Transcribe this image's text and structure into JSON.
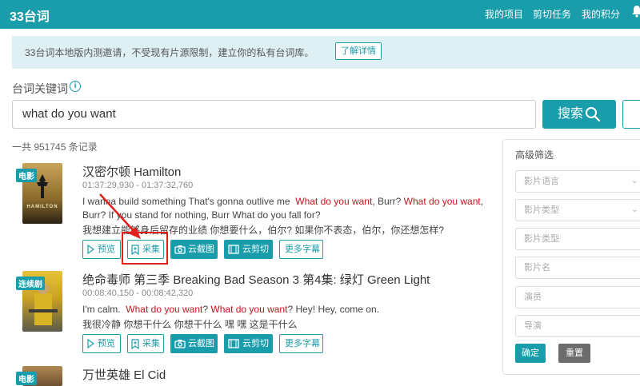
{
  "app": {
    "brand": "33台词",
    "nav": [
      "我的项目",
      "剪切任务",
      "我的积分"
    ]
  },
  "notice": {
    "text": "33台词本地版内测邀请，不受现有片源限制，建立你的私有台词库。",
    "button": "了解详情"
  },
  "search": {
    "label": "台词关键词",
    "value": "what do you want",
    "button": "搜索"
  },
  "total": "一共 951745 条记录",
  "results": [
    {
      "badge": "电影",
      "title": "汉密尔顿 Hamilton",
      "timecode": "01:37:29,930 - 01:37:32,760",
      "en_line1_a": "I wanna build something That's gonna outlive me",
      "en_line1_hl1": "What do you want",
      "en_line1_b": ", Burr?",
      "en_line1_hl2": "What do you want",
      "en_line1_c": ",",
      "en_line2": "Burr? If you stand for nothing, Burr What do you fall for?",
      "zh_line": "我想建立能够身后留存的业绩  你想要什么，伯尔?  如果你不表态，伯尔，你还想怎样?",
      "poster_text": "HAMILTON"
    },
    {
      "badge": "连续剧",
      "title": "绝命毒师 第三季 Breaking Bad Season 3 第4集: 绿灯 Green Light",
      "timecode": "00:08:40,150 - 00:08:42,320",
      "en_a": "I'm calm.",
      "en_hl1": "What do you want",
      "en_b": "?",
      "en_hl2": "What do you want",
      "en_c": "? Hey! Hey, come on.",
      "zh_line": "我很冷静  你想干什么  你想干什么  嘿  嘿  这是干什么"
    },
    {
      "badge": "电影",
      "title": "万世英雄 El Cid"
    }
  ],
  "actions": {
    "preview": "预览",
    "collect": "采集",
    "screenshot": "云截图",
    "cut": "云剪切",
    "more": "更多字幕"
  },
  "filter": {
    "title": "高级筛选",
    "fields": [
      "影片语言",
      "影片类型",
      "影片类型",
      "影片名",
      "演员",
      "导演"
    ],
    "confirm": "确定",
    "reset": "重置"
  },
  "colors": {
    "primary": "#1a9dab",
    "highlight": "#c4161c",
    "annotation": "#e0201c"
  }
}
